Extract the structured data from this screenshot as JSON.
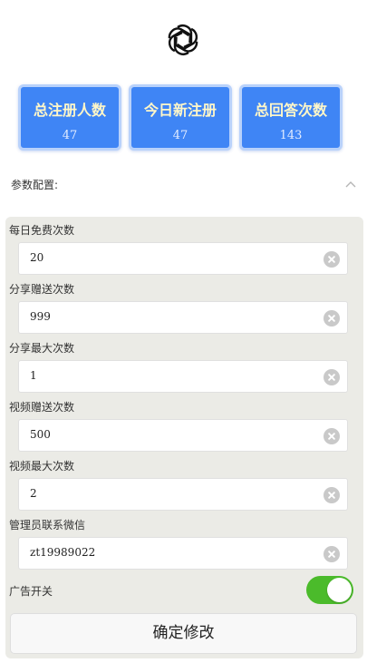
{
  "logo": {
    "icon": "openai-logo-icon"
  },
  "stats": [
    {
      "label": "总注册人数",
      "value": "47"
    },
    {
      "label": "今日新注册",
      "value": "47"
    },
    {
      "label": "总回答次数",
      "value": "143"
    }
  ],
  "config": {
    "title": "参数配置:",
    "collapse_icon": "chevron-up-icon",
    "fields": [
      {
        "label": "每日免费次数",
        "value": "20"
      },
      {
        "label": "分享赠送次数",
        "value": "999"
      },
      {
        "label": "分享最大次数",
        "value": "1"
      },
      {
        "label": "视频赠送次数",
        "value": "500"
      },
      {
        "label": "视频最大次数",
        "value": "2"
      },
      {
        "label": "管理员联系微信",
        "value": "zt19989022"
      }
    ],
    "toggle": {
      "label": "广告开关",
      "on": true
    },
    "submit_label": "确定修改"
  },
  "colors": {
    "stat_bg": "#3f85f5",
    "stat_label": "#fff7c8",
    "toggle_on": "#4bbb2b",
    "panel_bg": "#ebebe6"
  }
}
